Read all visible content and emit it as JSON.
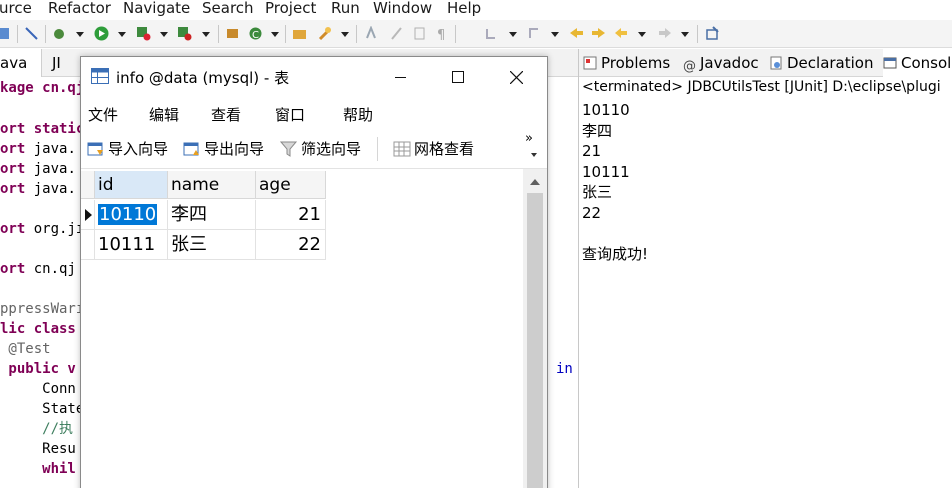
{
  "eclipse": {
    "menu": [
      "urce",
      "Refactor",
      "Navigate",
      "Search",
      "Project",
      "Run",
      "Window",
      "Help"
    ],
    "editor_tabs": [
      "ava",
      "JI"
    ],
    "code": {
      "line1": "kage cn.qj",
      "line2_kw": "ort static",
      "line3_kw": "ort",
      "line3_rest": " java.",
      "line4_kw": "ort",
      "line4_rest": " java.",
      "line5_kw": "ort",
      "line5_rest": " java.",
      "line6_kw": "ort",
      "line6_rest": " org.jı",
      "line7_kw": "ort",
      "line7_rest": " cn.qj",
      "line8": "ppressWarı",
      "line9_kw": "lic class",
      "line10": " @Test",
      "line11_kw": " public v",
      "line12": "     Conn",
      "line13": "     State",
      "line14": "     //执",
      "line15": "     Resu",
      "line16_kw": "     whil",
      "in_text": "in"
    },
    "views": {
      "tabs": [
        "Problems",
        "Javadoc",
        "Declaration",
        "Console"
      ],
      "console_header": "<terminated> JDBCUtilsTest [JUnit] D:\\eclipse\\plugi",
      "console_lines": [
        "10110",
        "李四",
        "21",
        "10111",
        "张三",
        "22",
        "",
        "查询成功!"
      ]
    }
  },
  "navicat": {
    "title": "info @data (mysql) - 表",
    "menu": [
      "文件",
      "编辑",
      "查看",
      "窗口",
      "帮助"
    ],
    "toolbar": {
      "import": "导入向导",
      "export": "导出向导",
      "filter": "筛选向导",
      "grid_view": "网格查看",
      "more": "»"
    },
    "grid": {
      "columns": [
        "id",
        "name",
        "age"
      ],
      "rows": [
        [
          "10110",
          "李四",
          "21"
        ],
        [
          "10111",
          "张三",
          "22"
        ]
      ]
    }
  },
  "colors": {
    "selection": "#0078d7",
    "keyword": "#7f0055",
    "comment": "#3f7f5f"
  }
}
